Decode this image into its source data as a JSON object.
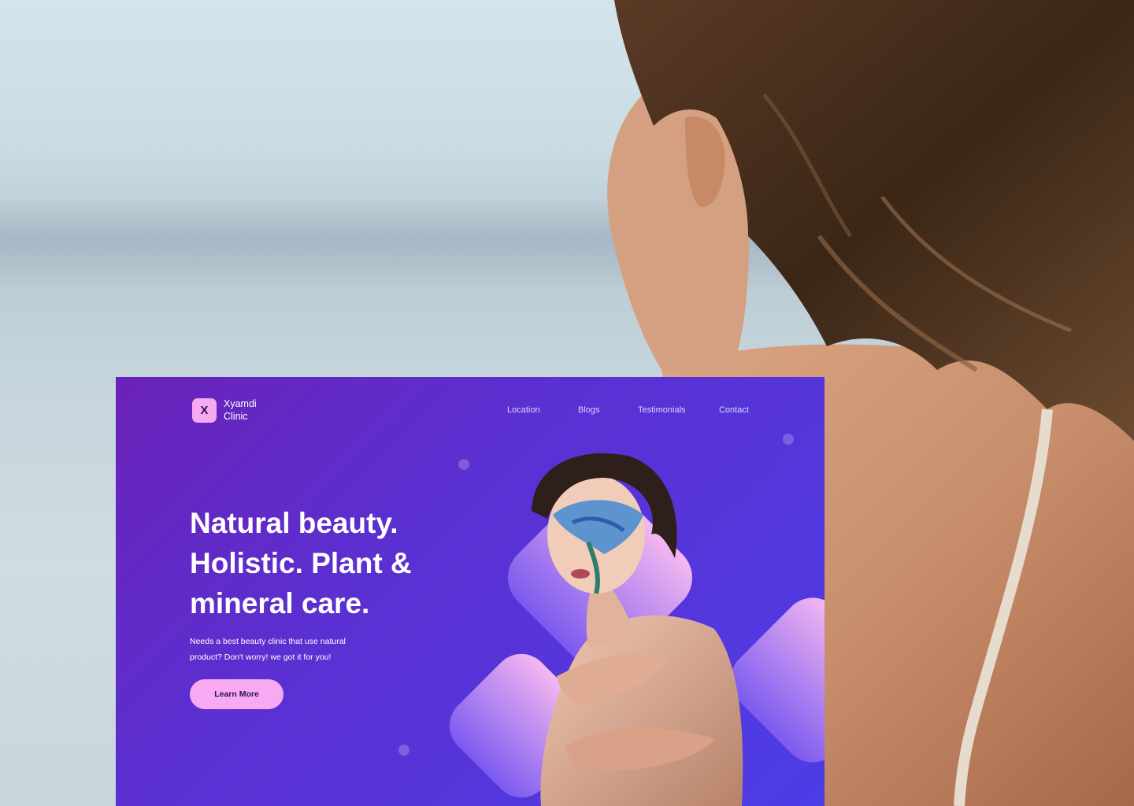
{
  "brand": {
    "logo_letter": "X",
    "name_line1": "Xyamdi",
    "name_line2": "Clinic"
  },
  "nav": {
    "items": [
      {
        "label": "Location"
      },
      {
        "label": "Blogs"
      },
      {
        "label": "Testimonials"
      },
      {
        "label": "Contact"
      }
    ]
  },
  "hero": {
    "headline_line1": "Natural beauty.",
    "headline_line2": "Holistic. Plant &",
    "headline_line3": "mineral care.",
    "subtext_line1": "Needs a best beauty clinic that use natural",
    "subtext_line2": "product? Don't worry! we got it for you!",
    "cta_label": "Learn More"
  },
  "colors": {
    "accent_pink": "#f7a9f2",
    "landing_gradient_start": "#6a22b8",
    "landing_gradient_end": "#4c3de6",
    "text_dark": "#2a1448"
  },
  "icons": {
    "logo": "logo-mark-icon"
  }
}
